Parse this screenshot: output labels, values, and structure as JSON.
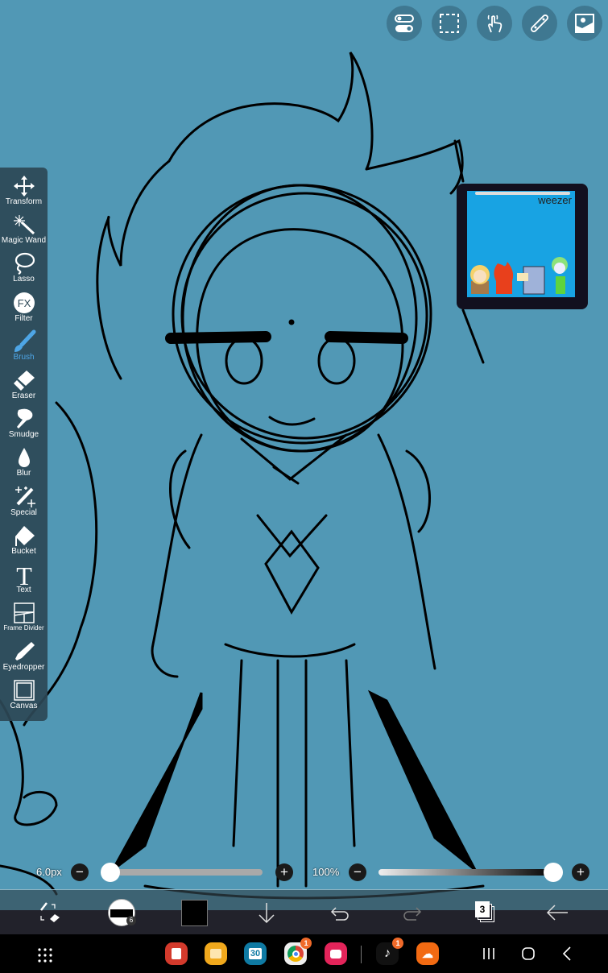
{
  "top_buttons": [
    {
      "name": "toggle-icon"
    },
    {
      "name": "selection-icon"
    },
    {
      "name": "touch-icon"
    },
    {
      "name": "ruler-icon"
    },
    {
      "name": "image-icon"
    }
  ],
  "tools": [
    {
      "id": "transform",
      "label": "Transform"
    },
    {
      "id": "magic-wand",
      "label": "Magic Wand"
    },
    {
      "id": "lasso",
      "label": "Lasso"
    },
    {
      "id": "filter",
      "label": "Filter"
    },
    {
      "id": "brush",
      "label": "Brush",
      "active": true
    },
    {
      "id": "eraser",
      "label": "Eraser"
    },
    {
      "id": "smudge",
      "label": "Smudge"
    },
    {
      "id": "blur",
      "label": "Blur"
    },
    {
      "id": "special",
      "label": "Special"
    },
    {
      "id": "bucket",
      "label": "Bucket"
    },
    {
      "id": "text",
      "label": "Text"
    },
    {
      "id": "frame-divider",
      "label": "Frame Divider"
    },
    {
      "id": "eyedropper",
      "label": "Eyedropper"
    },
    {
      "id": "canvas",
      "label": "Canvas"
    }
  ],
  "reference": {
    "title": "weezer"
  },
  "brush": {
    "size_label": "6.0px",
    "size_fraction": 0.0,
    "opacity_label": "100%",
    "opacity_fraction": 1.0
  },
  "bottom": {
    "layer_count": "3",
    "brush_badge": "6",
    "color": "#000000"
  },
  "taskbar": {
    "calendar_date": "30",
    "chrome_badge": "1",
    "tiktok_badge": "1"
  },
  "colors": {
    "accent": "#4ea6e6",
    "canvas": "#5198b5"
  }
}
